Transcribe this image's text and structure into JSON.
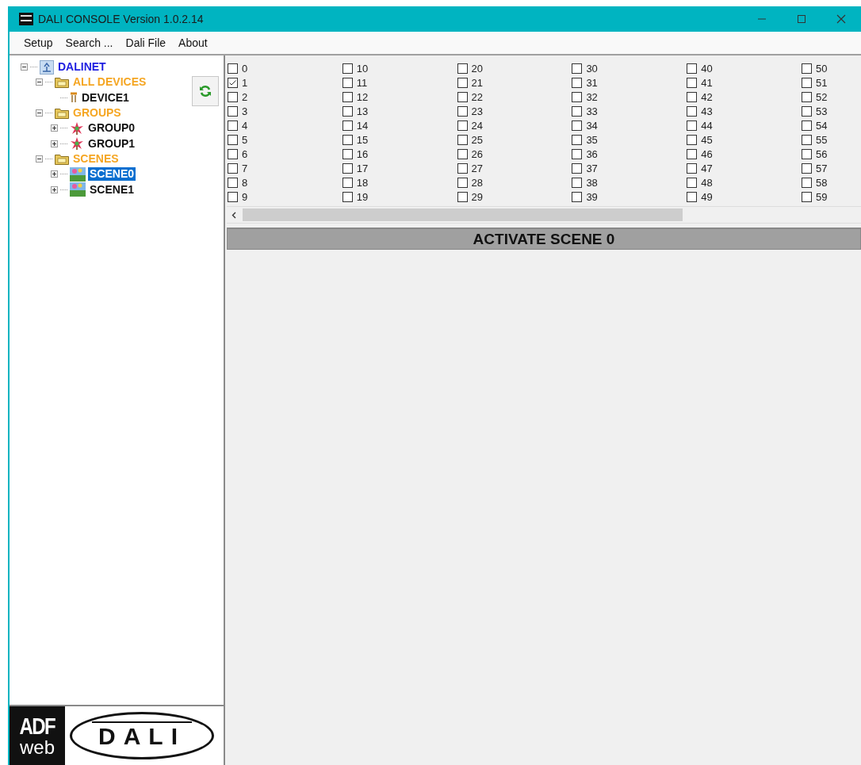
{
  "window": {
    "title": "DALI CONSOLE Version 1.0.2.14"
  },
  "menu": [
    "Setup",
    "Search ...",
    "Dali File",
    "About"
  ],
  "tree": [
    {
      "label": "DALINET",
      "kind": "root",
      "expanded": true,
      "selected": false,
      "children": [
        {
          "label": "ALL DEVICES",
          "kind": "folder",
          "expanded": true,
          "selected": false,
          "children": [
            {
              "label": "DEVICE1",
              "kind": "device",
              "selected": false
            }
          ]
        },
        {
          "label": "GROUPS",
          "kind": "folder",
          "expanded": true,
          "selected": false,
          "children": [
            {
              "label": "GROUP0",
              "kind": "group",
              "expanded": false,
              "selected": false
            },
            {
              "label": "GROUP1",
              "kind": "group",
              "expanded": false,
              "selected": false
            }
          ]
        },
        {
          "label": "SCENES",
          "kind": "folder",
          "expanded": true,
          "selected": false,
          "children": [
            {
              "label": "SCENE0",
              "kind": "scene",
              "expanded": false,
              "selected": true
            },
            {
              "label": "SCENE1",
              "kind": "scene",
              "expanded": false,
              "selected": false
            }
          ]
        }
      ]
    }
  ],
  "addresses": [
    {
      "label": "0",
      "checked": false
    },
    {
      "label": "1",
      "checked": true
    },
    {
      "label": "2",
      "checked": false
    },
    {
      "label": "3",
      "checked": false
    },
    {
      "label": "4",
      "checked": false
    },
    {
      "label": "5",
      "checked": false
    },
    {
      "label": "6",
      "checked": false
    },
    {
      "label": "7",
      "checked": false
    },
    {
      "label": "8",
      "checked": false
    },
    {
      "label": "9",
      "checked": false
    },
    {
      "label": "10",
      "checked": false
    },
    {
      "label": "11",
      "checked": false
    },
    {
      "label": "12",
      "checked": false
    },
    {
      "label": "13",
      "checked": false
    },
    {
      "label": "14",
      "checked": false
    },
    {
      "label": "15",
      "checked": false
    },
    {
      "label": "16",
      "checked": false
    },
    {
      "label": "17",
      "checked": false
    },
    {
      "label": "18",
      "checked": false
    },
    {
      "label": "19",
      "checked": false
    },
    {
      "label": "20",
      "checked": false
    },
    {
      "label": "21",
      "checked": false
    },
    {
      "label": "22",
      "checked": false
    },
    {
      "label": "23",
      "checked": false
    },
    {
      "label": "24",
      "checked": false
    },
    {
      "label": "25",
      "checked": false
    },
    {
      "label": "26",
      "checked": false
    },
    {
      "label": "27",
      "checked": false
    },
    {
      "label": "28",
      "checked": false
    },
    {
      "label": "29",
      "checked": false
    },
    {
      "label": "30",
      "checked": false
    },
    {
      "label": "31",
      "checked": false
    },
    {
      "label": "32",
      "checked": false
    },
    {
      "label": "33",
      "checked": false
    },
    {
      "label": "34",
      "checked": false
    },
    {
      "label": "35",
      "checked": false
    },
    {
      "label": "36",
      "checked": false
    },
    {
      "label": "37",
      "checked": false
    },
    {
      "label": "38",
      "checked": false
    },
    {
      "label": "39",
      "checked": false
    },
    {
      "label": "40",
      "checked": false
    },
    {
      "label": "41",
      "checked": false
    },
    {
      "label": "42",
      "checked": false
    },
    {
      "label": "43",
      "checked": false
    },
    {
      "label": "44",
      "checked": false
    },
    {
      "label": "45",
      "checked": false
    },
    {
      "label": "46",
      "checked": false
    },
    {
      "label": "47",
      "checked": false
    },
    {
      "label": "48",
      "checked": false
    },
    {
      "label": "49",
      "checked": false
    },
    {
      "label": "50",
      "checked": false
    },
    {
      "label": "51",
      "checked": false
    },
    {
      "label": "52",
      "checked": false
    },
    {
      "label": "53",
      "checked": false
    },
    {
      "label": "54",
      "checked": false
    },
    {
      "label": "55",
      "checked": false
    },
    {
      "label": "56",
      "checked": false
    },
    {
      "label": "57",
      "checked": false
    },
    {
      "label": "58",
      "checked": false
    },
    {
      "label": "59",
      "checked": false
    }
  ],
  "activate_button": "ACTIVATE SCENE 0",
  "logo": {
    "brand_top": "ADF",
    "brand_bottom": "web",
    "dali": "DALI"
  }
}
